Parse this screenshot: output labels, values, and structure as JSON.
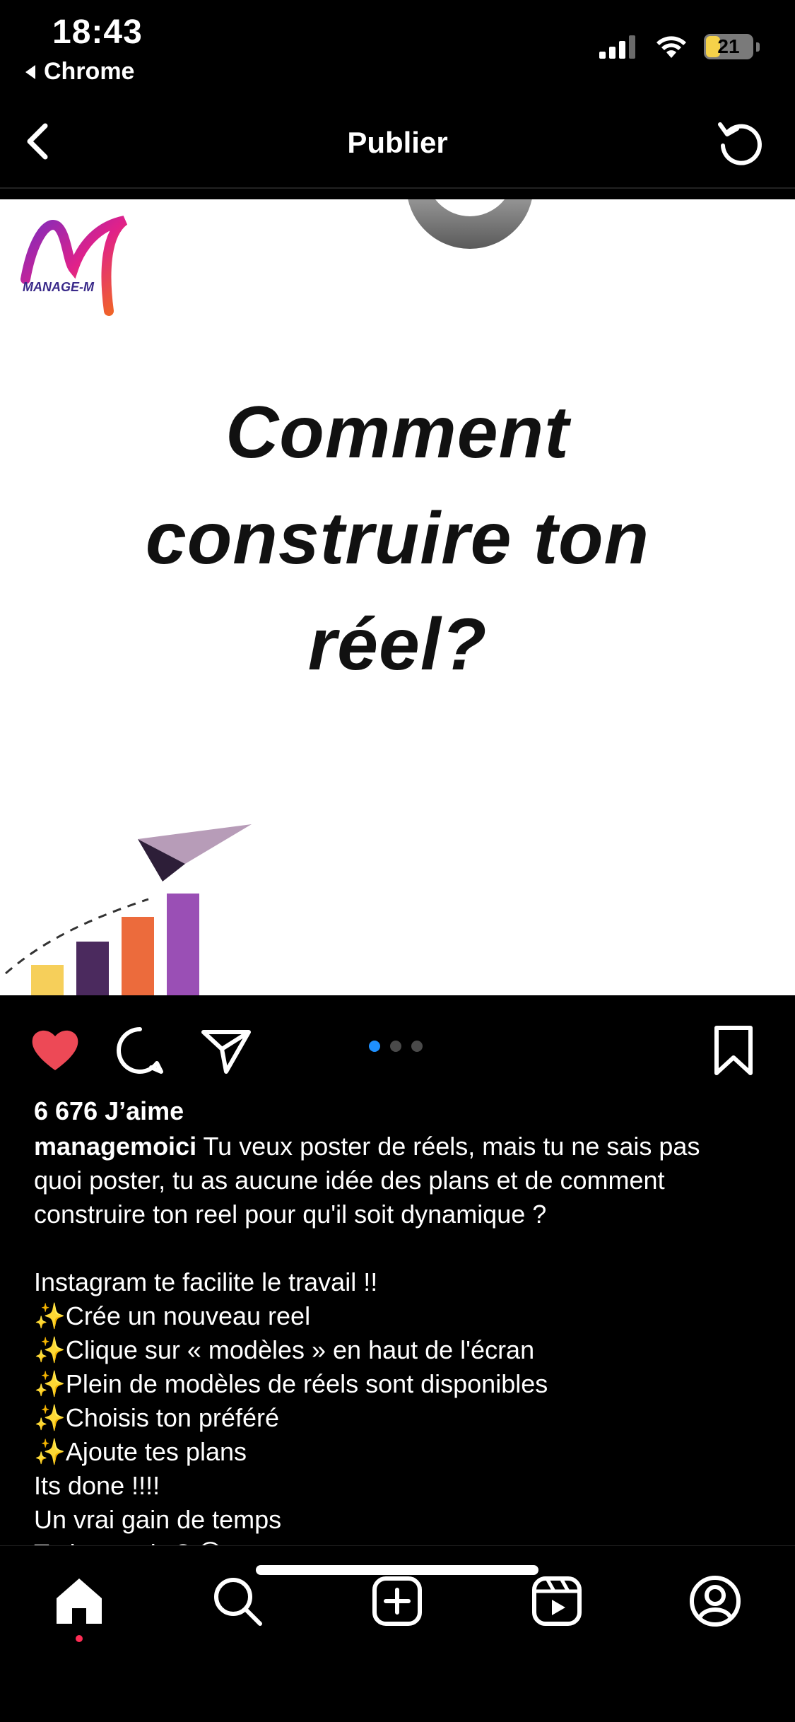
{
  "status_bar": {
    "time": "18:43",
    "back_app": "Chrome",
    "battery": "21"
  },
  "header": {
    "title": "Publier"
  },
  "post_image": {
    "logo_text": "MANAGE-MOI",
    "headline_lines": [
      "Comment",
      "construire ton",
      "réel?"
    ]
  },
  "carousel": {
    "count": 3,
    "active_index": 0
  },
  "post": {
    "likes": "6 676 J’aime",
    "username": "managemoici",
    "caption_first": "Tu veux poster de réels, mais tu ne sais pas",
    "caption_lines": [
      "quoi poster, tu as aucune idée des plans et de comment",
      "construire ton reel pour qu'il soit dynamique ?",
      "",
      "Instagram te facilite le travail !!",
      "✨Crée un nouveau reel",
      "✨Clique sur « modèles » en haut de l'écran",
      "✨Plein de modèles de réels sont disponibles",
      "✨Choisis ton préféré",
      "✨Ajoute tes plans",
      "Its done !!!!",
      "Un vrai gain de temps",
      "Tu le savais ? 😁"
    ]
  },
  "colors": {
    "accent_like": "#ed4956",
    "active_dot": "#1e90ff"
  },
  "nav": [
    "home-icon",
    "search-icon",
    "create-icon",
    "reels-icon",
    "profile-icon"
  ]
}
